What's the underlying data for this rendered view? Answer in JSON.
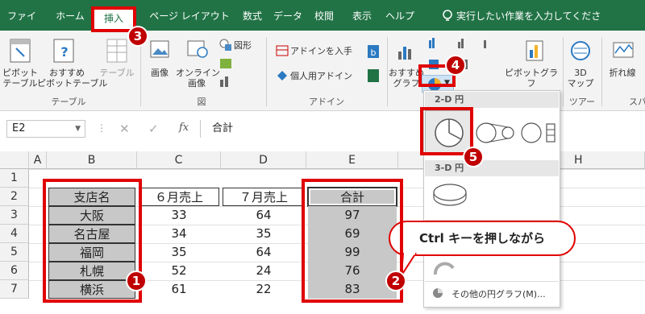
{
  "tabs": [
    "ファイル",
    "ホーム",
    "挿入",
    "ページ レイアウト",
    "数式",
    "データ",
    "校閲",
    "表示",
    "ヘルプ"
  ],
  "tell_me": "実行したい作業を入力してください",
  "ribbon": {
    "pivot": "ピボット\nテーブル",
    "rec_pivot": "おすすめ\nピボットテーブル",
    "table": "テーブル",
    "image": "画像",
    "online_image": "オンライン\n画像",
    "shapes": "図形",
    "get_addins": "アドインを入手",
    "personal_addins": "個人用アドイン",
    "rec_chart": "おすすめ\nグラフ",
    "pivot_chart": "ピボットグラフ",
    "map3d": "3D\nマップ",
    "line": "折れ線",
    "spark": "スパ",
    "group_table": "テーブル",
    "group_figure": "図",
    "group_addin": "アドイン",
    "group_tour": "ツアー"
  },
  "formula_bar": {
    "name_box": "E2",
    "fx": "fx",
    "value": "合計"
  },
  "columns": [
    "A",
    "B",
    "C",
    "D",
    "E",
    "H"
  ],
  "rows": [
    "1",
    "2",
    "3",
    "4",
    "5",
    "6",
    "7"
  ],
  "table": {
    "headers": [
      "支店名",
      "６月売上",
      "７月売上",
      "合計"
    ],
    "data": [
      [
        "大阪",
        "33",
        "64",
        "97"
      ],
      [
        "名古屋",
        "34",
        "35",
        "69"
      ],
      [
        "福岡",
        "35",
        "64",
        "99"
      ],
      [
        "札幌",
        "52",
        "24",
        "76"
      ],
      [
        "横浜",
        "61",
        "22",
        "83"
      ]
    ]
  },
  "popup": {
    "sec2d": "2-D 円",
    "sec3d": "3-D 円",
    "more": "その他の円グラフ(M)..."
  },
  "callout": "Ctrl キーを押しながら",
  "badges": [
    "1",
    "2",
    "3",
    "4",
    "5"
  ],
  "accent": "#217346",
  "marker": "#e00000"
}
